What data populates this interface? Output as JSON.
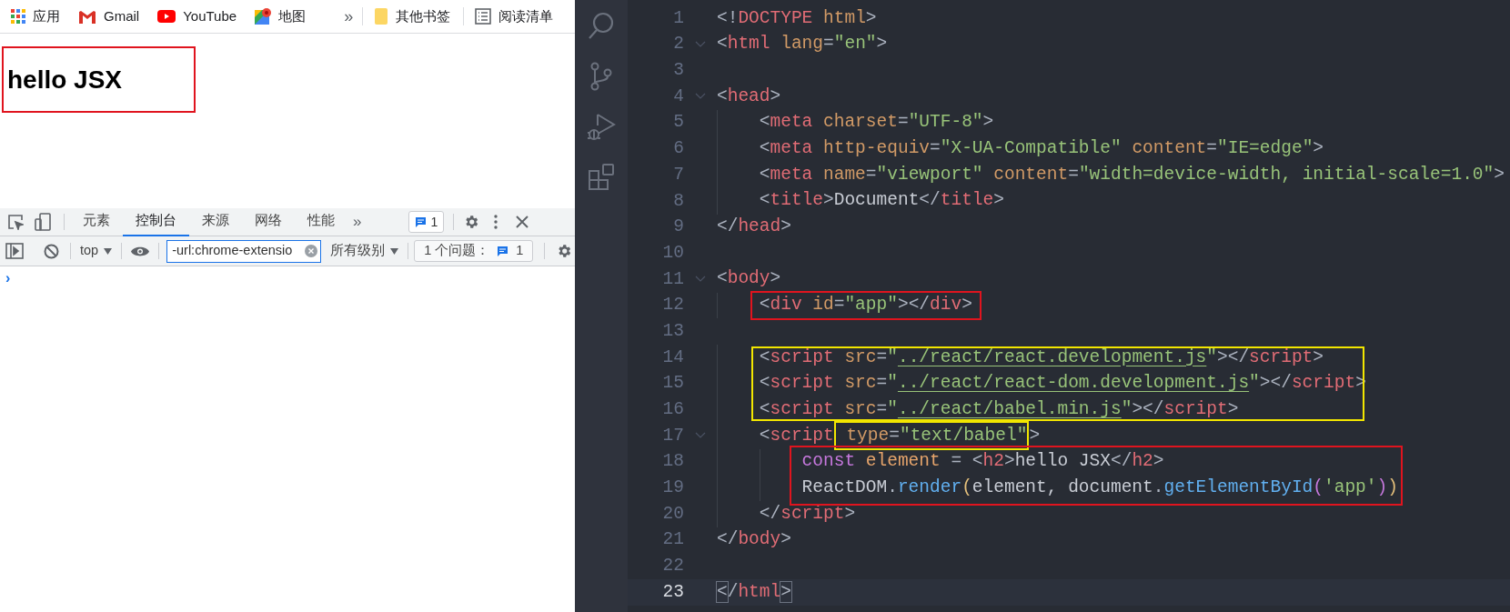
{
  "bookmarks": [
    {
      "kind": "apps",
      "label": "应用"
    },
    {
      "kind": "gmail",
      "label": "Gmail"
    },
    {
      "kind": "youtube",
      "label": "YouTube"
    },
    {
      "kind": "maps",
      "label": "地图"
    },
    {
      "kind": "more",
      "label": "»"
    },
    {
      "kind": "folder",
      "label": "其他书签"
    },
    {
      "kind": "reading",
      "label": "阅读清单"
    }
  ],
  "page": {
    "heading": "hello JSX"
  },
  "devtools": {
    "tabs": [
      {
        "label": "元素",
        "selected": false
      },
      {
        "label": "控制台",
        "selected": true
      },
      {
        "label": "来源",
        "selected": false
      },
      {
        "label": "网络",
        "selected": false
      },
      {
        "label": "性能",
        "selected": false
      }
    ],
    "more_tabs": "»",
    "issues_badge": "1",
    "context": "top",
    "filter": "-url:chrome-extensio",
    "levels": "所有级别",
    "issues_label": "1 个问题：",
    "issues_count": "1",
    "prompt": "›"
  },
  "editor": {
    "lines": [
      {
        "number": "1",
        "foldable": false,
        "current": false,
        "tokens": [
          {
            "kind": "p",
            "text": "<!"
          },
          {
            "kind": "tag",
            "text": "DOCTYPE"
          },
          {
            "kind": "attr",
            "text": " html"
          },
          {
            "kind": "p",
            "text": ">"
          }
        ]
      },
      {
        "number": "2",
        "foldable": true,
        "current": false,
        "tokens": [
          {
            "kind": "p",
            "text": "<"
          },
          {
            "kind": "tag",
            "text": "html"
          },
          {
            "kind": "attr",
            "text": " lang"
          },
          {
            "kind": "p",
            "text": "="
          },
          {
            "kind": "str",
            "text": "\"en\""
          },
          {
            "kind": "p",
            "text": ">"
          }
        ]
      },
      {
        "number": "3",
        "foldable": false,
        "current": false
      },
      {
        "number": "4",
        "foldable": true,
        "current": false,
        "tokens": [
          {
            "kind": "p",
            "text": "<"
          },
          {
            "kind": "tag",
            "text": "head"
          },
          {
            "kind": "p",
            "text": ">"
          }
        ]
      },
      {
        "number": "5",
        "foldable": false,
        "current": false,
        "tokens": [
          {
            "kind": "p",
            "text": "    <"
          },
          {
            "kind": "tag",
            "text": "meta"
          },
          {
            "kind": "attr",
            "text": " charset"
          },
          {
            "kind": "p",
            "text": "="
          },
          {
            "kind": "str",
            "text": "\"UTF-8\""
          },
          {
            "kind": "p",
            "text": ">"
          }
        ]
      },
      {
        "number": "6",
        "foldable": false,
        "current": false,
        "tokens": [
          {
            "kind": "p",
            "text": "    <"
          },
          {
            "kind": "tag",
            "text": "meta"
          },
          {
            "kind": "attr",
            "text": " http-equiv"
          },
          {
            "kind": "p",
            "text": "="
          },
          {
            "kind": "str",
            "text": "\"X-UA-Compatible\""
          },
          {
            "kind": "attr",
            "text": " content"
          },
          {
            "kind": "p",
            "text": "="
          },
          {
            "kind": "str",
            "text": "\"IE=edge\""
          },
          {
            "kind": "p",
            "text": ">"
          }
        ]
      },
      {
        "number": "7",
        "foldable": false,
        "current": false,
        "tokens": [
          {
            "kind": "p",
            "text": "    <"
          },
          {
            "kind": "tag",
            "text": "meta"
          },
          {
            "kind": "attr",
            "text": " name"
          },
          {
            "kind": "p",
            "text": "="
          },
          {
            "kind": "str",
            "text": "\"viewport\""
          },
          {
            "kind": "attr",
            "text": " content"
          },
          {
            "kind": "p",
            "text": "="
          },
          {
            "kind": "str",
            "text": "\"width=device-width, initial-scale=1.0\""
          },
          {
            "kind": "p",
            "text": ">"
          }
        ]
      },
      {
        "number": "8",
        "foldable": false,
        "current": false,
        "tokens": [
          {
            "kind": "p",
            "text": "    <"
          },
          {
            "kind": "tag",
            "text": "title"
          },
          {
            "kind": "p",
            "text": ">"
          },
          {
            "kind": "text",
            "text": "Document"
          },
          {
            "kind": "p",
            "text": "</"
          },
          {
            "kind": "tag",
            "text": "title"
          },
          {
            "kind": "p",
            "text": ">"
          }
        ]
      },
      {
        "number": "9",
        "foldable": false,
        "current": false,
        "tokens": [
          {
            "kind": "p",
            "text": "</"
          },
          {
            "kind": "tag",
            "text": "head"
          },
          {
            "kind": "p",
            "text": ">"
          }
        ]
      },
      {
        "number": "10",
        "foldable": false,
        "current": false
      },
      {
        "number": "11",
        "foldable": true,
        "current": false,
        "tokens": [
          {
            "kind": "p",
            "text": "<"
          },
          {
            "kind": "tag",
            "text": "body"
          },
          {
            "kind": "p",
            "text": ">"
          }
        ]
      },
      {
        "number": "12",
        "foldable": false,
        "current": false,
        "tokens": [
          {
            "kind": "p",
            "text": "    <"
          },
          {
            "kind": "tag",
            "text": "div"
          },
          {
            "kind": "attr",
            "text": " id"
          },
          {
            "kind": "p",
            "text": "="
          },
          {
            "kind": "str",
            "text": "\"app\""
          },
          {
            "kind": "p",
            "text": "></"
          },
          {
            "kind": "tag",
            "text": "div"
          },
          {
            "kind": "p",
            "text": ">"
          }
        ]
      },
      {
        "number": "13",
        "foldable": false,
        "current": false
      },
      {
        "number": "14",
        "foldable": false,
        "current": false,
        "tokens": [
          {
            "kind": "p",
            "text": "    <"
          },
          {
            "kind": "tag",
            "text": "script"
          },
          {
            "kind": "attr",
            "text": " src"
          },
          {
            "kind": "p",
            "text": "="
          },
          {
            "kind": "str",
            "text": "\""
          },
          {
            "kind": "link",
            "text": "../react/react.development.js"
          },
          {
            "kind": "str",
            "text": "\""
          },
          {
            "kind": "p",
            "text": "></"
          },
          {
            "kind": "tag",
            "text": "script"
          },
          {
            "kind": "p",
            "text": ">"
          }
        ]
      },
      {
        "number": "15",
        "foldable": false,
        "current": false,
        "tokens": [
          {
            "kind": "p",
            "text": "    <"
          },
          {
            "kind": "tag",
            "text": "script"
          },
          {
            "kind": "attr",
            "text": " src"
          },
          {
            "kind": "p",
            "text": "="
          },
          {
            "kind": "str",
            "text": "\""
          },
          {
            "kind": "link",
            "text": "../react/react-dom.development.js"
          },
          {
            "kind": "str",
            "text": "\""
          },
          {
            "kind": "p",
            "text": "></"
          },
          {
            "kind": "tag",
            "text": "script"
          },
          {
            "kind": "p",
            "text": ">"
          }
        ]
      },
      {
        "number": "16",
        "foldable": false,
        "current": false,
        "tokens": [
          {
            "kind": "p",
            "text": "    <"
          },
          {
            "kind": "tag",
            "text": "script"
          },
          {
            "kind": "attr",
            "text": " src"
          },
          {
            "kind": "p",
            "text": "="
          },
          {
            "kind": "str",
            "text": "\""
          },
          {
            "kind": "link",
            "text": "../react/babel.min.js"
          },
          {
            "kind": "str",
            "text": "\""
          },
          {
            "kind": "p",
            "text": "></"
          },
          {
            "kind": "tag",
            "text": "script"
          },
          {
            "kind": "p",
            "text": ">"
          }
        ]
      },
      {
        "number": "17",
        "foldable": true,
        "current": false,
        "tokens": [
          {
            "kind": "p",
            "text": "    <"
          },
          {
            "kind": "tag",
            "text": "script"
          },
          {
            "kind": "attr",
            "text": " type"
          },
          {
            "kind": "p",
            "text": "="
          },
          {
            "kind": "str",
            "text": "\"text/babel\""
          },
          {
            "kind": "p",
            "text": ">"
          }
        ]
      },
      {
        "number": "18",
        "foldable": false,
        "current": false,
        "tokens": [
          {
            "kind": "kw",
            "text": "        const"
          },
          {
            "kind": "var",
            "text": " element"
          },
          {
            "kind": "p",
            "text": " = <"
          },
          {
            "kind": "tag",
            "text": "h2"
          },
          {
            "kind": "p",
            "text": ">"
          },
          {
            "kind": "text",
            "text": "hello JSX"
          },
          {
            "kind": "p",
            "text": "</"
          },
          {
            "kind": "tag",
            "text": "h2"
          },
          {
            "kind": "p",
            "text": ">"
          }
        ]
      },
      {
        "number": "19",
        "foldable": false,
        "current": false,
        "tokens": [
          {
            "kind": "text",
            "text": "        ReactDOM"
          },
          {
            "kind": "p",
            "text": "."
          },
          {
            "kind": "func",
            "text": "render"
          },
          {
            "kind": "paren1",
            "text": "("
          },
          {
            "kind": "text",
            "text": "element, document"
          },
          {
            "kind": "p",
            "text": "."
          },
          {
            "kind": "func",
            "text": "getElementById"
          },
          {
            "kind": "paren2",
            "text": "("
          },
          {
            "kind": "str",
            "text": "'app'"
          },
          {
            "kind": "paren2",
            "text": ")"
          },
          {
            "kind": "paren1",
            "text": ")"
          }
        ]
      },
      {
        "number": "20",
        "foldable": false,
        "current": false,
        "tokens": [
          {
            "kind": "p",
            "text": "    </"
          },
          {
            "kind": "tag",
            "text": "script"
          },
          {
            "kind": "p",
            "text": ">"
          }
        ]
      },
      {
        "number": "21",
        "foldable": false,
        "current": false,
        "tokens": [
          {
            "kind": "p",
            "text": "</"
          },
          {
            "kind": "tag",
            "text": "body"
          },
          {
            "kind": "p",
            "text": ">"
          }
        ]
      },
      {
        "number": "22",
        "foldable": false,
        "current": false
      },
      {
        "number": "23",
        "foldable": false,
        "current": true,
        "tokens": [
          {
            "kind": "match",
            "text": "<"
          },
          {
            "kind": "p",
            "text": "/"
          },
          {
            "kind": "tag",
            "text": "html"
          },
          {
            "kind": "match",
            "text": ">"
          }
        ]
      }
    ]
  }
}
